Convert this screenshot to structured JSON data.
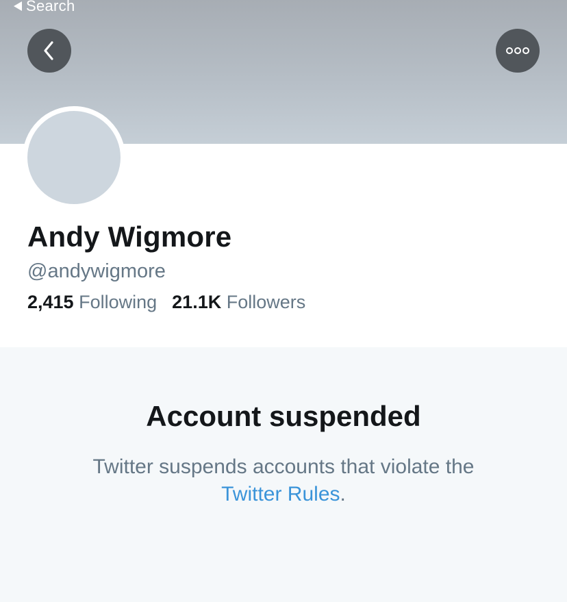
{
  "status_bar": {
    "back_label": "Search"
  },
  "header": {
    "back_icon": "chevron-left-icon",
    "more_icon": "more-horizontal-icon"
  },
  "profile": {
    "name": "Andy Wigmore",
    "handle": "@andywigmore",
    "following_count": "2,415",
    "following_label": "Following",
    "followers_count": "21.1K",
    "followers_label": "Followers"
  },
  "suspension": {
    "title": "Account suspended",
    "message_prefix": "Twitter suspends accounts that violate the",
    "link_text": "Twitter Rules",
    "message_suffix": "."
  },
  "colors": {
    "link": "#3b94d9",
    "secondary_text": "#657786",
    "primary_text": "#14171a",
    "button_bg": "#51565b"
  }
}
